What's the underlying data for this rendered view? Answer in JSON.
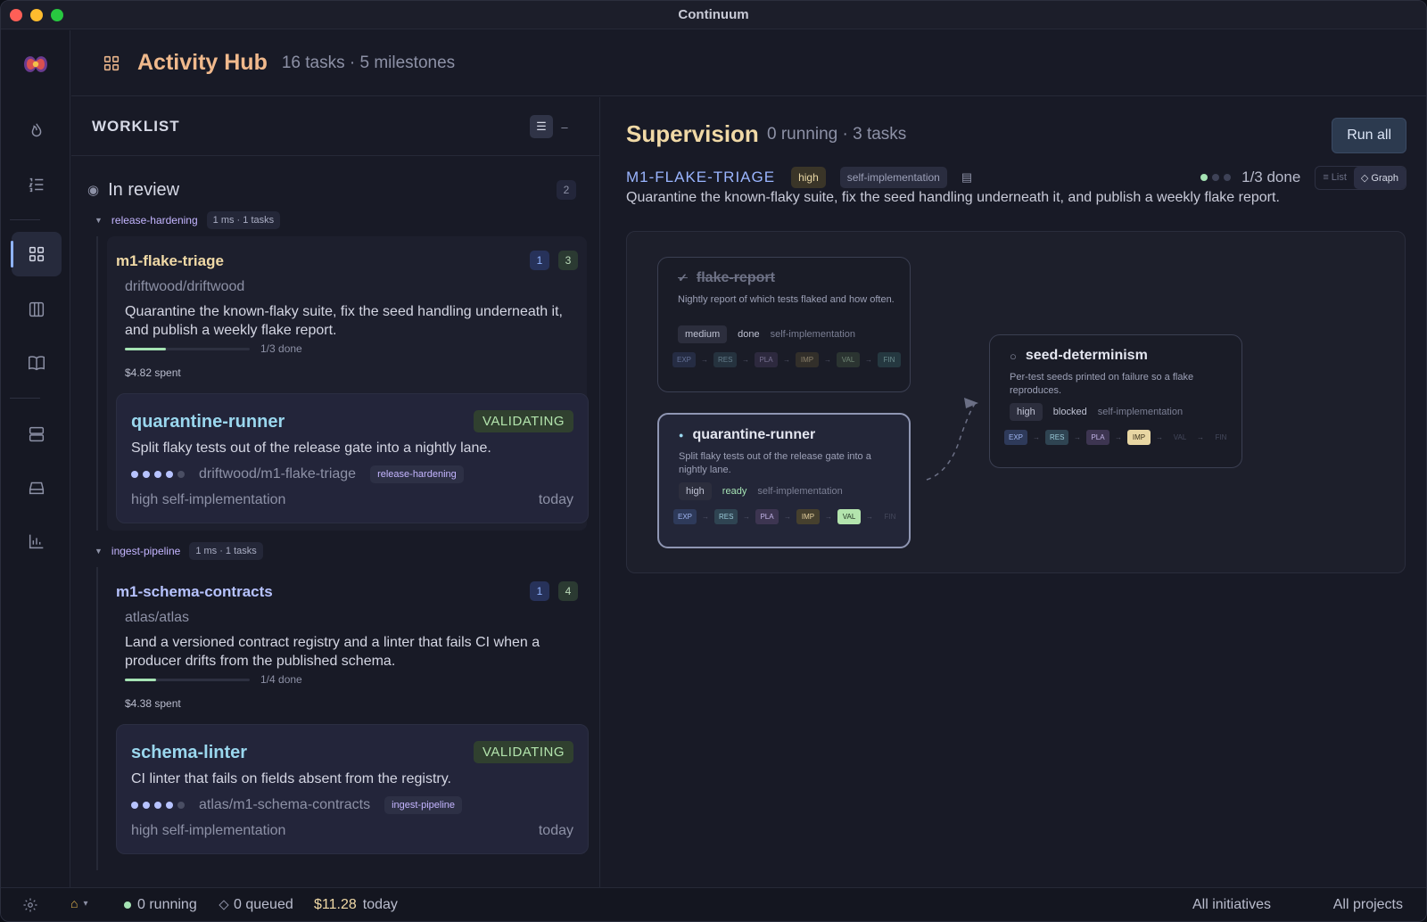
{
  "window": {
    "title": "Continuum"
  },
  "header": {
    "title": "Activity Hub",
    "meta": "16 tasks · 5 milestones"
  },
  "worklist": {
    "title": "WORKLIST",
    "section": {
      "title": "In review",
      "count": "2"
    },
    "groups": [
      {
        "name": "release-hardening",
        "pill": "1 ms · 1 tasks",
        "milestone": {
          "name": "m1-flake-triage",
          "badge_a": "1",
          "badge_b": "3",
          "repo": "driftwood/driftwood",
          "desc": "Quarantine the known-flaky suite, fix the seed handling underneath it, and publish a weekly flake report.",
          "progress": 0.33,
          "progress_label": "1/3 done",
          "spent": "$4.82 spent"
        },
        "task": {
          "name": "quarantine-runner",
          "status": "VALIDATING",
          "desc": "Split flaky tests out of the release gate into a nightly lane.",
          "dots_filled": 4,
          "branch": "driftwood/m1-flake-triage",
          "pill": "release-hardening",
          "foot": "high self-implementation",
          "when": "today"
        }
      },
      {
        "name": "ingest-pipeline",
        "pill": "1 ms · 1 tasks",
        "milestone": {
          "name": "m1-schema-contracts",
          "badge_a": "1",
          "badge_b": "4",
          "repo": "atlas/atlas",
          "desc": "Land a versioned contract registry and a linter that fails CI when a producer drifts from the published schema.",
          "progress": 0.25,
          "progress_label": "1/4 done",
          "spent": "$4.38 spent"
        },
        "task": {
          "name": "schema-linter",
          "status": "VALIDATING",
          "desc": "CI linter that fails on fields absent from the registry.",
          "dots_filled": 4,
          "branch": "atlas/m1-schema-contracts",
          "pill": "ingest-pipeline",
          "foot": "high self-implementation",
          "when": "today"
        }
      }
    ]
  },
  "supervision": {
    "title": "Supervision",
    "meta": "0 running · 3 tasks",
    "run_all": "Run all",
    "milestone_code": "M1-FLAKE-TRIAGE",
    "priority": "high",
    "mode": "self-implementation",
    "done_label": "1/3 done",
    "progress_done": 1,
    "progress_total": 3,
    "view_list": "≡ List",
    "view_graph": "◇ Graph",
    "desc": "Quarantine the known-flaky suite, fix the seed handling underneath it, and publish a weekly flake report.",
    "stage_labels": [
      "EXP",
      "RES",
      "PLA",
      "IMP",
      "VAL",
      "FIN"
    ],
    "nodes": [
      {
        "name": "flake-report",
        "state_mark": "✓",
        "desc": "Nightly report of which tests flaked and how often.",
        "priority": "medium",
        "status": "done",
        "mode": "self-implementation",
        "stage_active": "FIN"
      },
      {
        "name": "quarantine-runner",
        "state_mark": "●",
        "desc": "Split flaky tests out of the release gate into a nightly lane.",
        "priority": "high",
        "status": "ready",
        "mode": "self-implementation",
        "stage_active": "VAL"
      },
      {
        "name": "seed-determinism",
        "state_mark": "○",
        "desc": "Per-test seeds printed on failure so a flake reproduces.",
        "priority": "high",
        "status": "blocked",
        "mode": "self-implementation",
        "stage_active": "IMP"
      }
    ]
  },
  "statusbar": {
    "running": "0 running",
    "queued": "0 queued",
    "cost": "$11.28",
    "cost_suffix": "today",
    "initiatives": "All initiatives",
    "projects": "All projects"
  },
  "colors": {
    "accent": "#f0b98c",
    "success": "#a5e3b4",
    "link": "#9ad7ee",
    "milestone": "#f0d9a6"
  }
}
